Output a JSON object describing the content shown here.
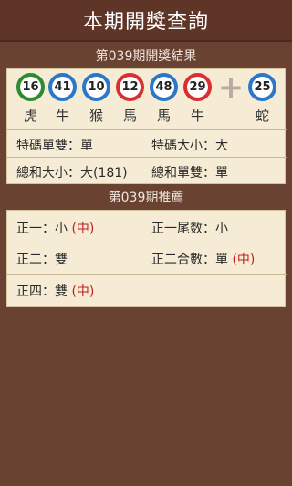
{
  "header": {
    "title": "本期開獎查詢"
  },
  "results": {
    "title": "第039期開獎結果",
    "balls": [
      {
        "number": "16",
        "zodiac": "虎",
        "color": "green"
      },
      {
        "number": "41",
        "zodiac": "牛",
        "color": "blue"
      },
      {
        "number": "10",
        "zodiac": "猴",
        "color": "blue"
      },
      {
        "number": "12",
        "zodiac": "馬",
        "color": "red"
      },
      {
        "number": "48",
        "zodiac": "馬",
        "color": "blue"
      },
      {
        "number": "29",
        "zodiac": "牛",
        "color": "red"
      }
    ],
    "plus_symbol": "+",
    "special": {
      "number": "25",
      "zodiac": "蛇",
      "color": "blue"
    },
    "stats": {
      "special_odd_even": "特碼單雙：單",
      "special_size": "特碼大小：大",
      "sum_size": "總和大小：大(181)",
      "sum_odd_even": "總和單雙：單"
    }
  },
  "recommend": {
    "title": "第039期推薦",
    "items": {
      "zheng1": {
        "label": "正一：小",
        "mark": "(中)"
      },
      "zheng1_tail": {
        "label": "正一尾数：小"
      },
      "zheng2": {
        "label": "正二：雙"
      },
      "zheng2_sum": {
        "label": "正二合數：單",
        "mark": "(中)"
      },
      "zheng4": {
        "label": "正四：雙",
        "mark": "(中)"
      }
    }
  },
  "colors": {
    "background": "#6a4231",
    "panel": "#f6ecd6",
    "hit_mark": "#c02020"
  }
}
